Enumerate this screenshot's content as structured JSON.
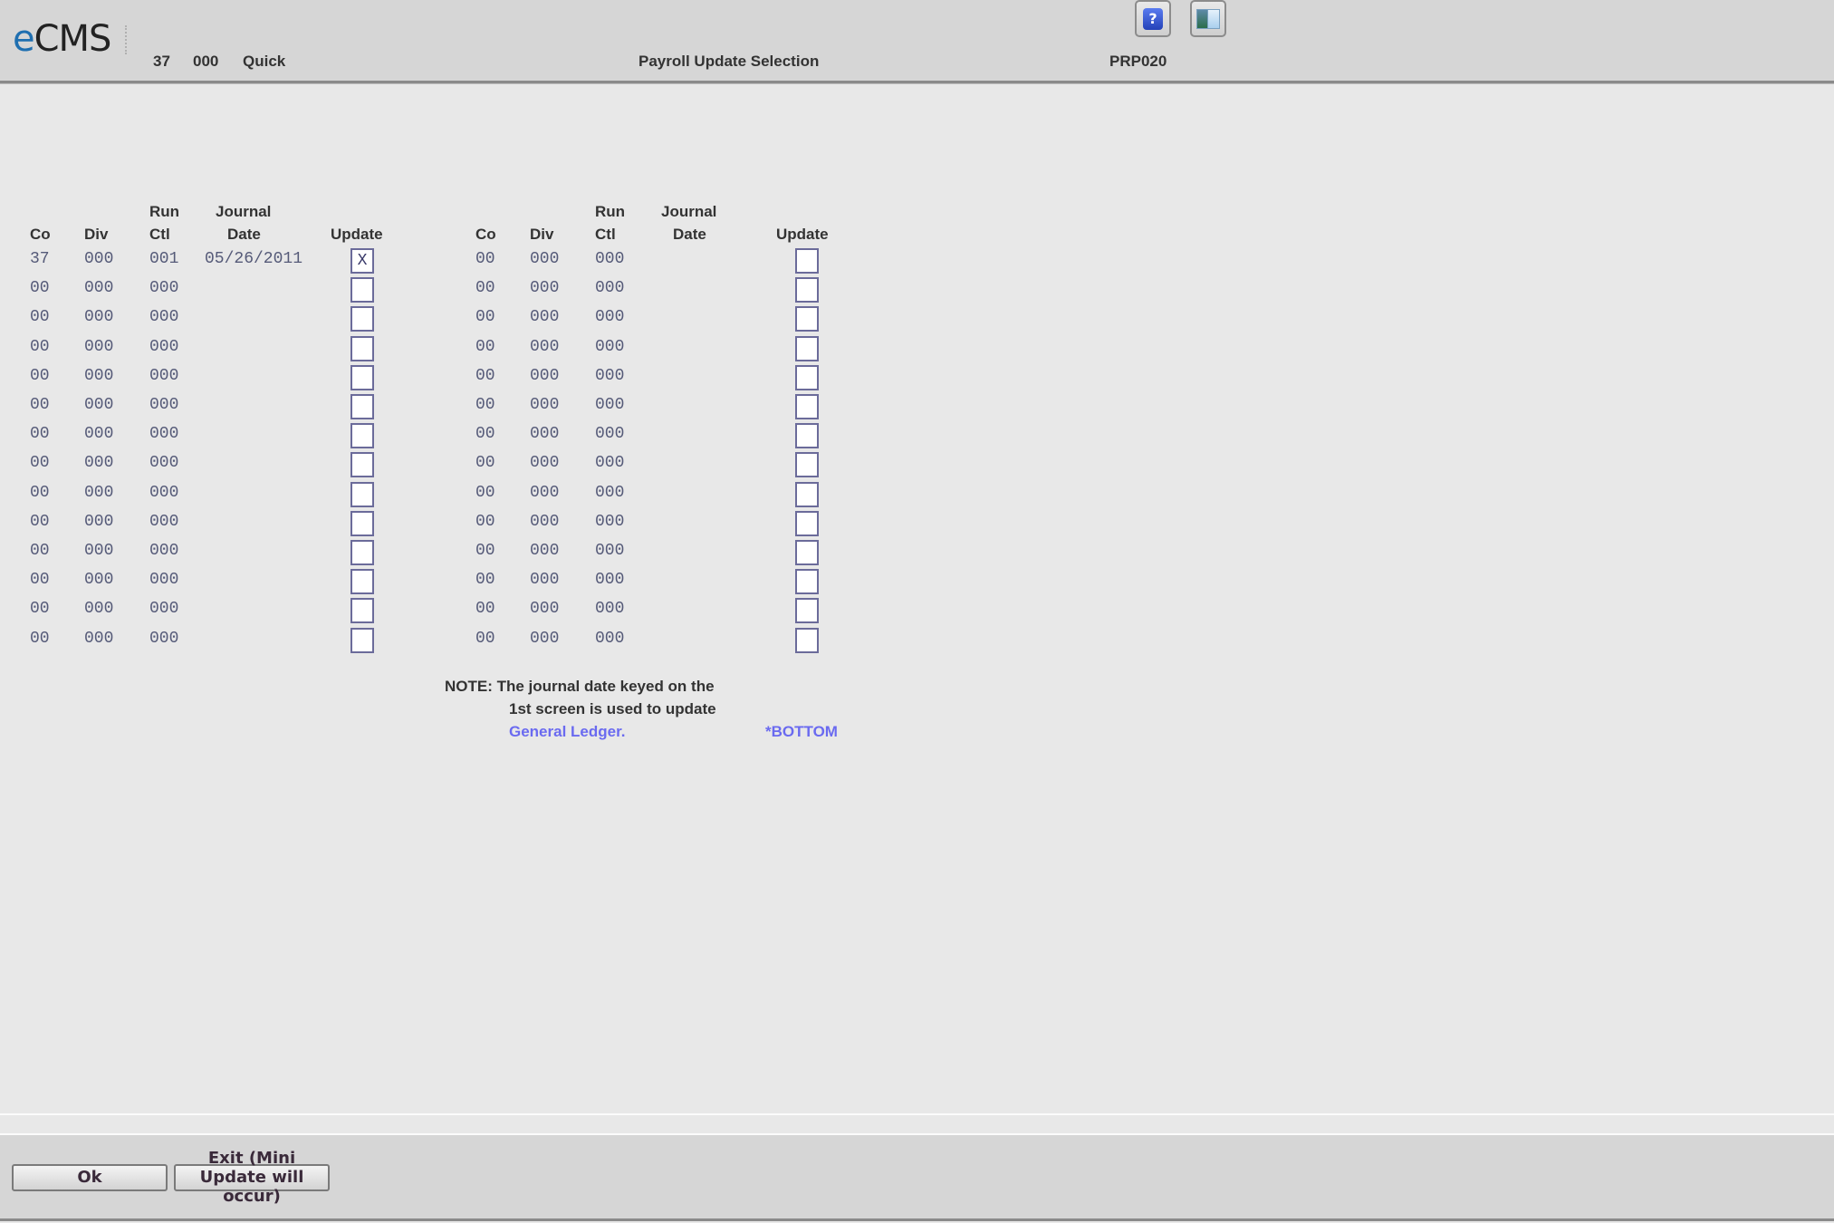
{
  "header": {
    "logo_prefix": "e",
    "logo_rest": "CMS",
    "company": "37",
    "division": "000",
    "mode": "Quick",
    "title": "Payroll Update Selection",
    "program_id": "PRP020",
    "icons": [
      "help-icon",
      "window-icon"
    ],
    "help_glyph": "?"
  },
  "columns": {
    "co": "Co",
    "div": "Div",
    "run_top": "Run",
    "run_bottom": "Ctl",
    "journal_top": "Journal",
    "journal_bottom": "Date",
    "update": "Update"
  },
  "left_rows": [
    {
      "co": "37",
      "div": "000",
      "ctl": "001",
      "date": "05/26/2011",
      "update": "X"
    },
    {
      "co": "00",
      "div": "000",
      "ctl": "000",
      "date": "",
      "update": ""
    },
    {
      "co": "00",
      "div": "000",
      "ctl": "000",
      "date": "",
      "update": ""
    },
    {
      "co": "00",
      "div": "000",
      "ctl": "000",
      "date": "",
      "update": ""
    },
    {
      "co": "00",
      "div": "000",
      "ctl": "000",
      "date": "",
      "update": ""
    },
    {
      "co": "00",
      "div": "000",
      "ctl": "000",
      "date": "",
      "update": ""
    },
    {
      "co": "00",
      "div": "000",
      "ctl": "000",
      "date": "",
      "update": ""
    },
    {
      "co": "00",
      "div": "000",
      "ctl": "000",
      "date": "",
      "update": ""
    },
    {
      "co": "00",
      "div": "000",
      "ctl": "000",
      "date": "",
      "update": ""
    },
    {
      "co": "00",
      "div": "000",
      "ctl": "000",
      "date": "",
      "update": ""
    },
    {
      "co": "00",
      "div": "000",
      "ctl": "000",
      "date": "",
      "update": ""
    },
    {
      "co": "00",
      "div": "000",
      "ctl": "000",
      "date": "",
      "update": ""
    },
    {
      "co": "00",
      "div": "000",
      "ctl": "000",
      "date": "",
      "update": ""
    },
    {
      "co": "00",
      "div": "000",
      "ctl": "000",
      "date": "",
      "update": ""
    }
  ],
  "right_rows": [
    {
      "co": "00",
      "div": "000",
      "ctl": "000",
      "date": "",
      "update": ""
    },
    {
      "co": "00",
      "div": "000",
      "ctl": "000",
      "date": "",
      "update": ""
    },
    {
      "co": "00",
      "div": "000",
      "ctl": "000",
      "date": "",
      "update": ""
    },
    {
      "co": "00",
      "div": "000",
      "ctl": "000",
      "date": "",
      "update": ""
    },
    {
      "co": "00",
      "div": "000",
      "ctl": "000",
      "date": "",
      "update": ""
    },
    {
      "co": "00",
      "div": "000",
      "ctl": "000",
      "date": "",
      "update": ""
    },
    {
      "co": "00",
      "div": "000",
      "ctl": "000",
      "date": "",
      "update": ""
    },
    {
      "co": "00",
      "div": "000",
      "ctl": "000",
      "date": "",
      "update": ""
    },
    {
      "co": "00",
      "div": "000",
      "ctl": "000",
      "date": "",
      "update": ""
    },
    {
      "co": "00",
      "div": "000",
      "ctl": "000",
      "date": "",
      "update": ""
    },
    {
      "co": "00",
      "div": "000",
      "ctl": "000",
      "date": "",
      "update": ""
    },
    {
      "co": "00",
      "div": "000",
      "ctl": "000",
      "date": "",
      "update": ""
    },
    {
      "co": "00",
      "div": "000",
      "ctl": "000",
      "date": "",
      "update": ""
    },
    {
      "co": "00",
      "div": "000",
      "ctl": "000",
      "date": "",
      "update": ""
    }
  ],
  "note": {
    "line1": "NOTE: The journal date keyed on the",
    "line2": "1st screen is used to update",
    "line3": "General Ledger.",
    "bottom_marker": "*BOTTOM"
  },
  "footer": {
    "ok_label": "Ok",
    "exit_label": "Exit (Mini Update will occur)"
  },
  "colors": {
    "accent_link": "#6a6af0",
    "logo_e": "#1f6fb0"
  }
}
